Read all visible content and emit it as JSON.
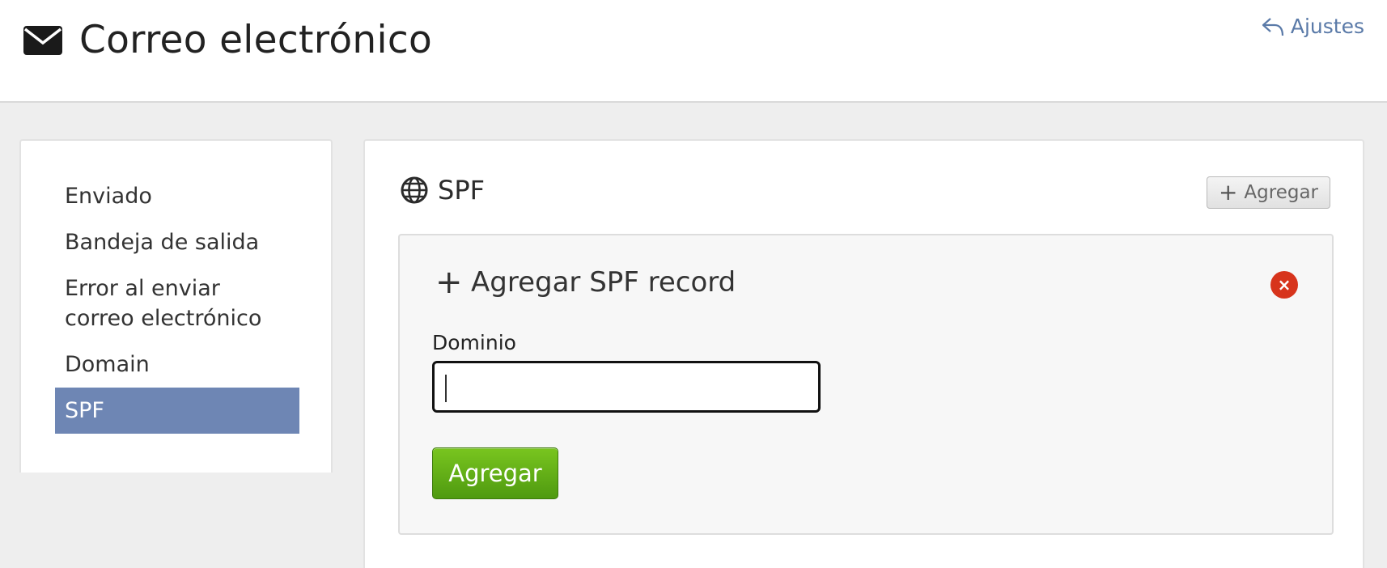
{
  "header": {
    "title": "Correo electrónico",
    "title_icon": "envelope-icon",
    "settings_link": "Ajustes",
    "settings_icon": "reply-arrow-icon"
  },
  "sidebar": {
    "items": [
      {
        "label": "Enviado"
      },
      {
        "label": "Bandeja de salida"
      },
      {
        "label": "Error al enviar correo electrónico"
      },
      {
        "label": "Domain"
      },
      {
        "label": "SPF",
        "active": true
      }
    ]
  },
  "main": {
    "section_title": "SPF",
    "section_icon": "globe-icon",
    "add_button": "Agregar",
    "form": {
      "title": "Agregar SPF record",
      "field_label": "Dominio",
      "field_value": "",
      "submit_label": "Agregar"
    }
  },
  "colors": {
    "active_nav": "#6e86b4",
    "link": "#5a7aa8",
    "submit": "#5ea915",
    "close": "#d7341c"
  }
}
